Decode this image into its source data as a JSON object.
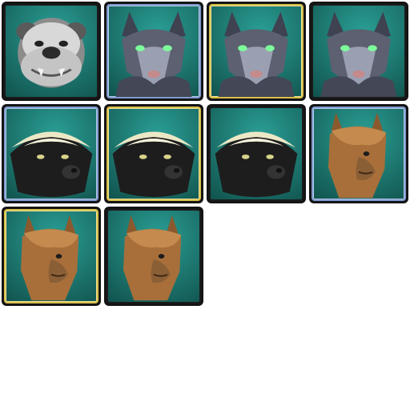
{
  "colors": {
    "bg_teal": "#2a9f95",
    "bg_teal_dark": "#11524d",
    "frame_blue": "#7f9bd0",
    "frame_gold": "#d8c04a",
    "frame_dark": "#1b1b1b"
  },
  "portraits": [
    {
      "character": "bulldog",
      "frame": "dark"
    },
    {
      "character": "wolf",
      "frame": "blue"
    },
    {
      "character": "wolf",
      "frame": "gold"
    },
    {
      "character": "wolf",
      "frame": "dark"
    },
    {
      "character": "honey-badger",
      "frame": "blue"
    },
    {
      "character": "honey-badger",
      "frame": "gold"
    },
    {
      "character": "honey-badger",
      "frame": "dark"
    },
    {
      "character": "alpaca",
      "frame": "blue"
    },
    {
      "character": "alpaca",
      "frame": "gold"
    },
    {
      "character": "alpaca",
      "frame": "dark"
    }
  ]
}
